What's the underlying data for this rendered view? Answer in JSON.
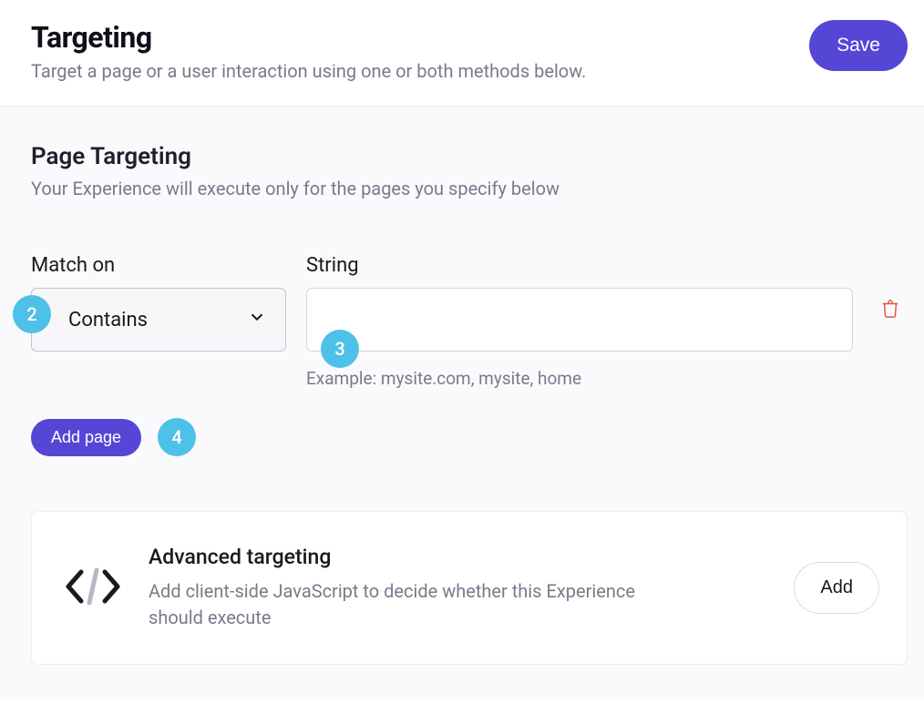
{
  "header": {
    "title": "Targeting",
    "subtitle": "Target a page or a user interaction using one or both methods below.",
    "save_label": "Save"
  },
  "page_targeting": {
    "title": "Page Targeting",
    "subtitle": "Your Experience will execute only for the pages you specify below",
    "match_label": "Match on",
    "match_value": "Contains",
    "string_label": "String",
    "string_value": "",
    "string_hint": "Example: mysite.com, mysite, home",
    "add_page_label": "Add page"
  },
  "badges": {
    "match": "2",
    "string": "3",
    "add_page": "4"
  },
  "advanced": {
    "title": "Advanced targeting",
    "description": "Add client-side JavaScript to decide whether this Experience should execute",
    "add_label": "Add"
  }
}
